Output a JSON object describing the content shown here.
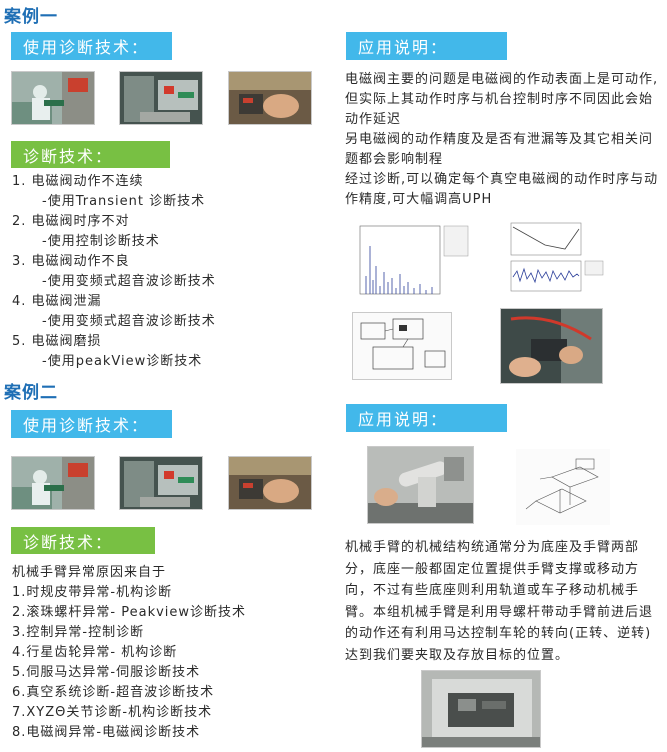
{
  "case1": {
    "title": "案例一",
    "diag_label": "使用诊断技术：",
    "tech_label": "诊断技术：",
    "items": [
      {
        "main": "1. 电磁阀动作不连续",
        "sub": "-使用Transient 诊断技术"
      },
      {
        "main": "2. 电磁阀时序不对",
        "sub": "-使用控制诊断技术"
      },
      {
        "main": "3. 电磁阀动作不良",
        "sub": "-使用变频式超音波诊断技术"
      },
      {
        "main": "4. 电磁阀泄漏",
        "sub": "-使用变频式超音波诊断技术"
      },
      {
        "main": "5. 电磁阀磨损",
        "sub": "-使用peakView诊断技术"
      }
    ],
    "app_label": "应用说明：",
    "app_paragraphs": [
      "电磁阀主要的问题是电磁阀的作动表面上是可动作,但实际上其动作时序与机台控制时序不同因此会始动作延迟",
      "另电磁阀的动作精度及是否有泄漏等及其它相关问题都会影响制程",
      "经过诊断,可以确定每个真空电磁阀的动作时序与动作精度,可大幅调高UPH"
    ]
  },
  "case2": {
    "title": "案例二",
    "diag_label": "使用诊断技术：",
    "tech_label": "诊断技术：",
    "intro": "机械手臂异常原因来自于",
    "items": [
      "1.时规皮带异常-机构诊断",
      "2.滚珠螺杆异常- Peakview诊断技术",
      "3.控制异常-控制诊断",
      "4.行星齿轮异常- 机构诊断",
      "5.伺服马达异常-伺服诊断技术",
      "6.真空系统诊断-超音波诊断技术",
      "7.XYZΘ关节诊断-机构诊断技术",
      "8.电磁阀异常-电磁阀诊断技术"
    ],
    "app_label": "应用说明：",
    "app_paragraph": "机械手臂的机械结构统通常分为底座及手臂两部分，底座一般都固定位置提供手臂支撑或移动方向，不过有些底座则利用轨道或车子移动机械手臂。本组机械手臂是利用导螺杆带动手臂前进后退的动作还有利用马达控制车轮的转向(正转、逆转)达到我们要夹取及存放目标的位置。"
  },
  "colors": {
    "accent_blue": "#42b8ea",
    "accent_green": "#78c043",
    "title_blue": "#1f6fb5"
  }
}
